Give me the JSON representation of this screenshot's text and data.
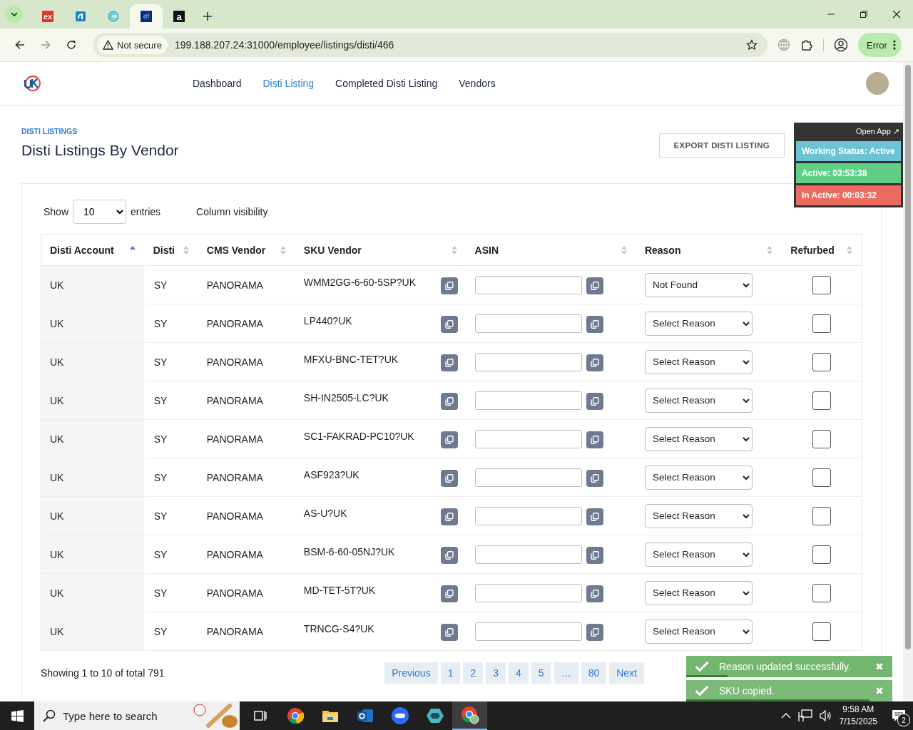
{
  "browser": {
    "tabs": [
      {
        "kind": "ex",
        "icon_text": "ex",
        "selected": false
      },
      {
        "kind": "blue",
        "selected": false
      },
      {
        "kind": "ring",
        "selected": false
      },
      {
        "kind": "df",
        "icon_text": "df",
        "selected": true
      },
      {
        "kind": "amazon",
        "icon_text": "a",
        "selected": false
      }
    ],
    "security": "Not secure",
    "url": "199.188.207.24:31000/employee/listings/disti/466",
    "profile_label": "Error"
  },
  "nav": {
    "items": [
      {
        "label": "Dashboard",
        "selected": false
      },
      {
        "label": "Disti Listing",
        "selected": true
      },
      {
        "label": "Completed Disti Listing",
        "selected": false
      },
      {
        "label": "Vendors",
        "selected": false
      }
    ]
  },
  "header": {
    "breadcrumb": "DISTI LISTINGS",
    "title": "Disti Listings By Vendor",
    "export_button": "EXPORT DISTI LISTING"
  },
  "status_panel": {
    "open_app": "Open App ↗",
    "items": [
      {
        "label": "Working Status: Active",
        "color": "#6bc3d3"
      },
      {
        "label": "Active: 03:53:38",
        "color": "#5fcf86"
      },
      {
        "label": "In Active: 00:03:32",
        "color": "#ea6b60"
      }
    ]
  },
  "controls": {
    "show_label": "Show",
    "entries_value": "10",
    "entries_label": "entries",
    "column_visibility": "Column visibility"
  },
  "table": {
    "columns": [
      {
        "label": "Disti Account",
        "sorted": true
      },
      {
        "label": "Disti",
        "sorted": false
      },
      {
        "label": "CMS Vendor",
        "sorted": false
      },
      {
        "label": "SKU Vendor",
        "sorted": false
      },
      {
        "label": "ASIN",
        "sorted": false
      },
      {
        "label": "Reason",
        "sorted": false
      },
      {
        "label": "Refurbed",
        "sorted": false
      }
    ],
    "rows": [
      {
        "account": "UK",
        "disti": "SY",
        "vendor": "PANORAMA",
        "sku": "WMM2GG-6-60-5SP?UK",
        "reason": "Not Found",
        "refurbed": false
      },
      {
        "account": "UK",
        "disti": "SY",
        "vendor": "PANORAMA",
        "sku": "LP440?UK",
        "reason": "Select Reason",
        "refurbed": false
      },
      {
        "account": "UK",
        "disti": "SY",
        "vendor": "PANORAMA",
        "sku": "MFXU-BNC-TET?UK",
        "reason": "Select Reason",
        "refurbed": false
      },
      {
        "account": "UK",
        "disti": "SY",
        "vendor": "PANORAMA",
        "sku": "SH-IN2505-LC?UK",
        "reason": "Select Reason",
        "refurbed": false
      },
      {
        "account": "UK",
        "disti": "SY",
        "vendor": "PANORAMA",
        "sku": "SC1-FAKRAD-PC10?UK",
        "reason": "Select Reason",
        "refurbed": false
      },
      {
        "account": "UK",
        "disti": "SY",
        "vendor": "PANORAMA",
        "sku": "ASF923?UK",
        "reason": "Select Reason",
        "refurbed": false
      },
      {
        "account": "UK",
        "disti": "SY",
        "vendor": "PANORAMA",
        "sku": "AS-U?UK",
        "reason": "Select Reason",
        "refurbed": false
      },
      {
        "account": "UK",
        "disti": "SY",
        "vendor": "PANORAMA",
        "sku": "BSM-6-60-05NJ?UK",
        "reason": "Select Reason",
        "refurbed": false
      },
      {
        "account": "UK",
        "disti": "SY",
        "vendor": "PANORAMA",
        "sku": "MD-TET-5T?UK",
        "reason": "Select Reason",
        "refurbed": false
      },
      {
        "account": "UK",
        "disti": "SY",
        "vendor": "PANORAMA",
        "sku": "TRNCG-S4?UK",
        "reason": "Select Reason",
        "refurbed": false
      }
    ]
  },
  "footer": {
    "summary": "Showing 1 to 10 of total 791",
    "pagination": [
      "Previous",
      "1",
      "2",
      "3",
      "4",
      "5",
      "…",
      "80",
      "Next"
    ]
  },
  "toasts": [
    {
      "message": "Reason updated successfully.",
      "close": "✖",
      "level": 0.2
    },
    {
      "message": "SKU copied.",
      "close": "✖",
      "level": 0.89
    }
  ],
  "taskbar": {
    "search_placeholder": "Type here to search",
    "time": "9:58 AM",
    "date": "7/15/2025",
    "notification_count": "2"
  }
}
